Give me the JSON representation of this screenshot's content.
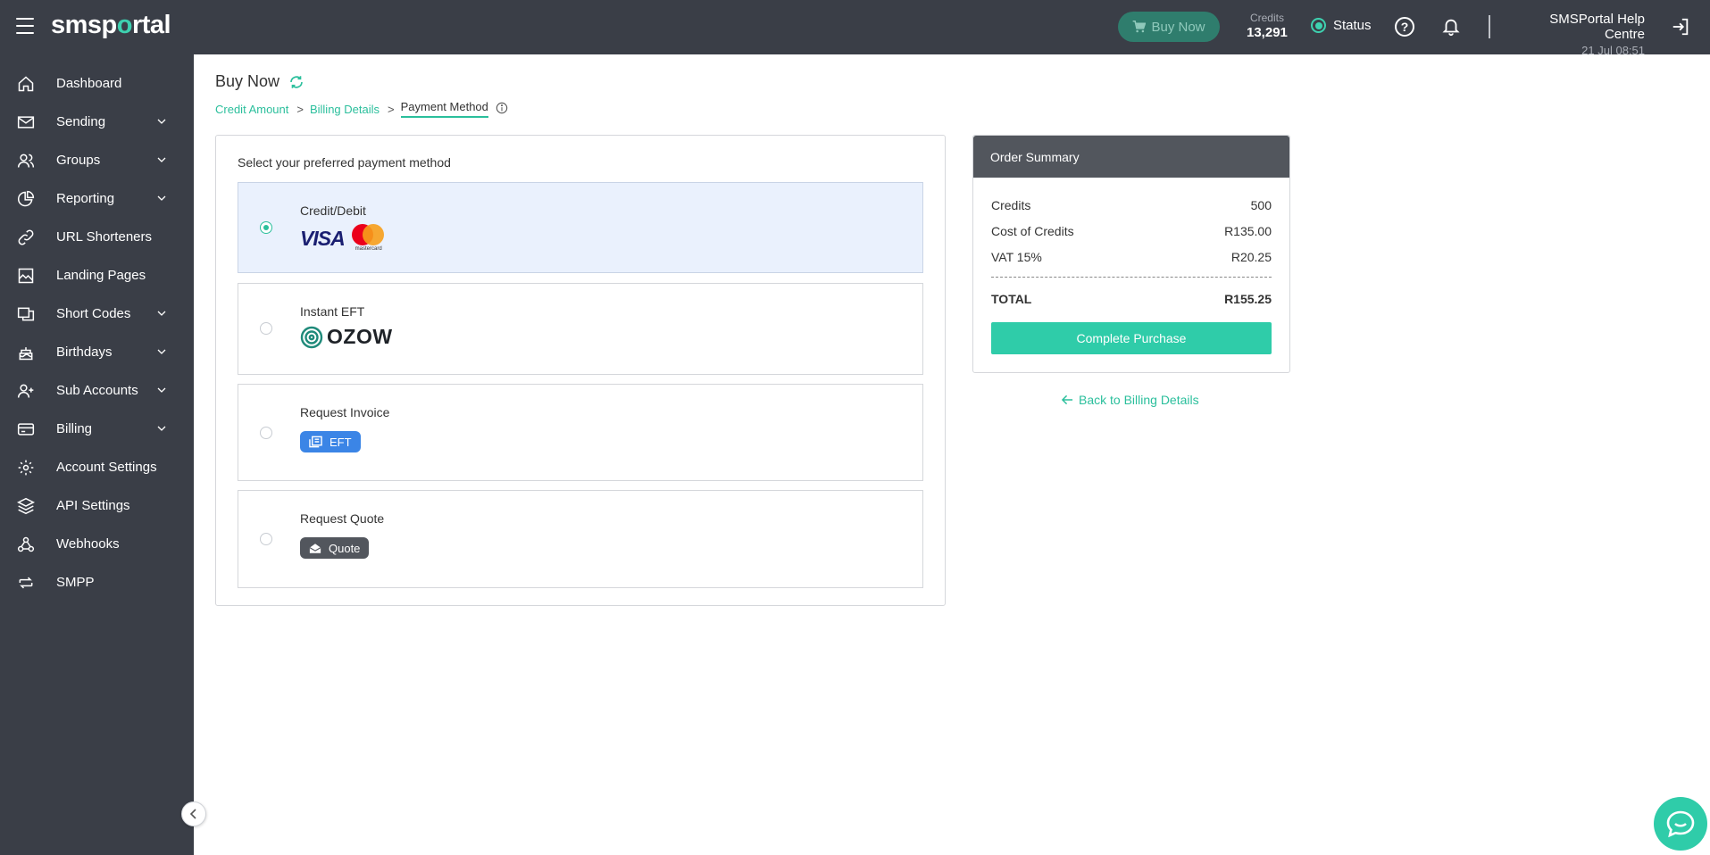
{
  "topbar": {
    "logo_pre": "sms",
    "logo_p": "p",
    "logo_o": "o",
    "logo_post": "rtal",
    "buy_now_label": "Buy Now",
    "credits_label": "Credits",
    "credits_value": "13,291",
    "status_label": "Status",
    "help_glyph": "?",
    "account_name": "SMSPortal Help Centre",
    "account_date": "21 Jul 08:51"
  },
  "sidebar": {
    "items": [
      {
        "label": "Dashboard",
        "icon": "home-icon"
      },
      {
        "label": "Sending",
        "icon": "envelope-icon"
      },
      {
        "label": "Groups",
        "icon": "users-icon"
      },
      {
        "label": "Reporting",
        "icon": "pie-chart-icon"
      },
      {
        "label": "URL Shorteners",
        "icon": "link-icon"
      },
      {
        "label": "Landing Pages",
        "icon": "landing-page-icon"
      },
      {
        "label": "Short Codes",
        "icon": "short-code-icon"
      },
      {
        "label": "Birthdays",
        "icon": "cake-icon"
      },
      {
        "label": "Sub Accounts",
        "icon": "add-user-icon"
      },
      {
        "label": "Billing",
        "icon": "credit-card-icon"
      },
      {
        "label": "Account Settings",
        "icon": "gear-icon"
      },
      {
        "label": "API Settings",
        "icon": "layers-icon"
      },
      {
        "label": "Webhooks",
        "icon": "webhook-icon"
      },
      {
        "label": "SMPP",
        "icon": "swap-icon"
      }
    ]
  },
  "page": {
    "title": "Buy Now",
    "breadcrumb": {
      "step1": "Credit Amount",
      "step2": "Billing Details",
      "step3": "Payment Method",
      "separator": ">"
    }
  },
  "payment": {
    "heading": "Select your preferred payment method",
    "options": [
      {
        "label": "Credit/Debit",
        "selected": true
      },
      {
        "label": "Instant EFT",
        "selected": false
      },
      {
        "label": "Request Invoice",
        "selected": false,
        "badge": "EFT"
      },
      {
        "label": "Request Quote",
        "selected": false,
        "badge": "Quote"
      }
    ],
    "visa_text": "VISA",
    "mastercard_text": "mastercard",
    "ozow_text": "OZOW"
  },
  "summary": {
    "header": "Order Summary",
    "rows": [
      {
        "label": "Credits",
        "value": "500"
      },
      {
        "label": "Cost of Credits",
        "value": "R135.00"
      },
      {
        "label": "VAT 15%",
        "value": "R20.25"
      }
    ],
    "total_label": "TOTAL",
    "total_value": "R155.25",
    "button_label": "Complete Purchase",
    "back_label": "Back to Billing Details"
  },
  "colors": {
    "accent": "#2bbf9c",
    "topbar": "#3a3e47",
    "selected_bg": "#eaf1fd",
    "eft_badge": "#3b85e6",
    "quote_badge": "#52565d"
  }
}
